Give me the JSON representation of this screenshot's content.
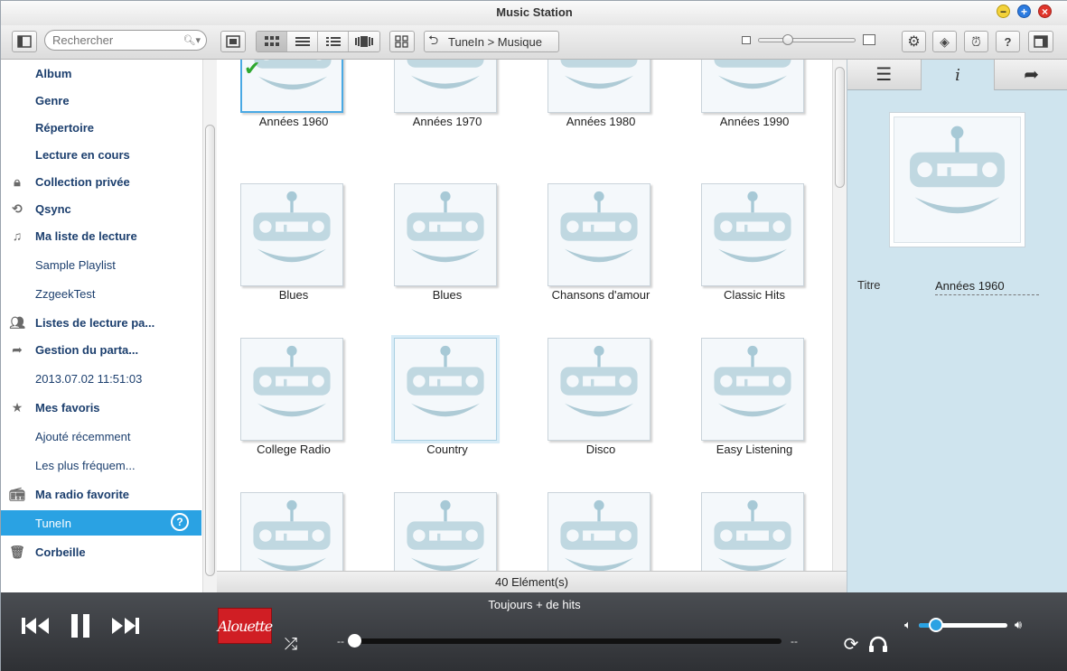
{
  "window": {
    "title": "Music Station"
  },
  "toolbar": {
    "search_placeholder": "Rechercher",
    "breadcrumb": "TuneIn > Musique",
    "view_modes": [
      "grid-view",
      "list-view",
      "detail-list-view",
      "coverflow-view"
    ],
    "active_view": "grid-view"
  },
  "sidebar": {
    "items": [
      {
        "label": "Album",
        "bold": true,
        "icon": ""
      },
      {
        "label": "Genre",
        "bold": true,
        "icon": ""
      },
      {
        "label": "Répertoire",
        "bold": true,
        "icon": ""
      },
      {
        "label": "Lecture en cours",
        "bold": true,
        "icon": ""
      },
      {
        "label": "Collection privée",
        "bold": true,
        "icon": "lock-icon"
      },
      {
        "label": "Qsync",
        "bold": true,
        "icon": "sync-icon"
      },
      {
        "label": "Ma liste de lecture",
        "bold": true,
        "icon": "playlist-icon"
      },
      {
        "label": "Sample Playlist",
        "bold": false,
        "icon": ""
      },
      {
        "label": "ZzgeekTest",
        "bold": false,
        "icon": ""
      },
      {
        "label": "Listes de lecture pa...",
        "bold": true,
        "icon": "users-icon"
      },
      {
        "label": "Gestion du parta...",
        "bold": true,
        "icon": "share-icon"
      },
      {
        "label": "2013.07.02 11:51:03",
        "bold": false,
        "icon": ""
      },
      {
        "label": "Mes favoris",
        "bold": true,
        "icon": "star-icon"
      },
      {
        "label": "Ajouté récemment",
        "bold": false,
        "icon": ""
      },
      {
        "label": "Les plus fréquem...",
        "bold": false,
        "icon": ""
      },
      {
        "label": "Ma radio favorite",
        "bold": true,
        "icon": "radio-icon"
      },
      {
        "label": "TuneIn",
        "bold": false,
        "icon": "",
        "selected": true,
        "help": "?"
      },
      {
        "label": "Corbeille",
        "bold": true,
        "icon": "trash-icon"
      }
    ]
  },
  "grid": {
    "tiles": [
      {
        "label": "Années 1960",
        "selected": true
      },
      {
        "label": "Années 1970"
      },
      {
        "label": "Années 1980"
      },
      {
        "label": "Années 1990"
      },
      {
        "label": "Blues"
      },
      {
        "label": "Blues"
      },
      {
        "label": "Chansons d'amour"
      },
      {
        "label": "Classic Hits"
      },
      {
        "label": "College Radio"
      },
      {
        "label": "Country",
        "hover": true
      },
      {
        "label": "Disco"
      },
      {
        "label": "Easy Listening"
      },
      {
        "label": ""
      },
      {
        "label": ""
      },
      {
        "label": ""
      },
      {
        "label": ""
      }
    ]
  },
  "status": {
    "count_text": "40 Elément(s)"
  },
  "details": {
    "tabs": [
      "menu-icon",
      "info-icon",
      "share-icon"
    ],
    "active_tab": "info-icon",
    "title_label": "Titre",
    "title_value": "Années 1960"
  },
  "player": {
    "now_playing": "Toujours + de hits",
    "elapsed": "--",
    "remaining": "--",
    "progress": 0,
    "volume": 0.2,
    "album_art_text": "Alouette"
  },
  "colors": {
    "accent": "#2aa2e3",
    "sidebar_text": "#1c3f6e",
    "panel_bg": "#cfe4ee",
    "player_bg": "#3a3d42"
  }
}
